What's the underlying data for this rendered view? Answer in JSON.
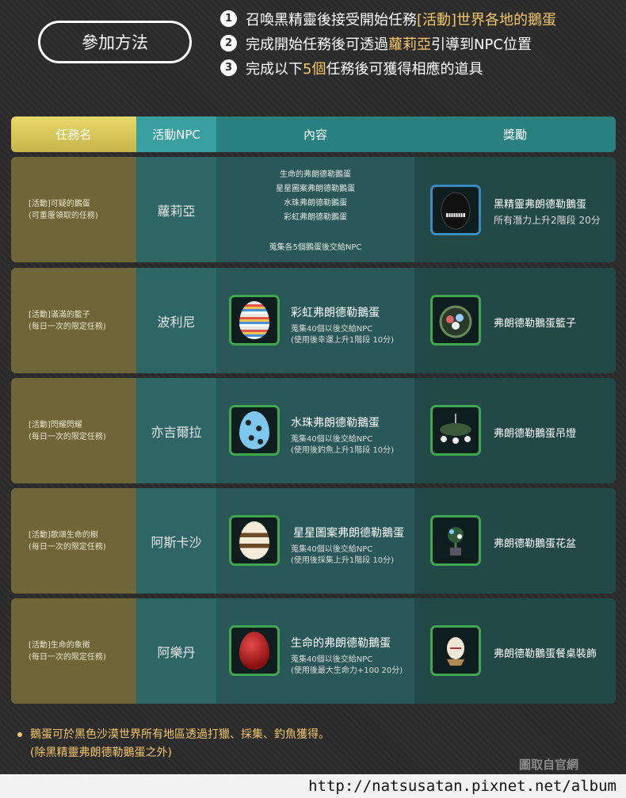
{
  "join_label": "參加方法",
  "steps": [
    {
      "num": "1",
      "pre": "召喚黑精靈後接受開始任務",
      "highlight": "[活動]世界各地的鵝蛋",
      "post": ""
    },
    {
      "num": "2",
      "pre": "完成開始任務後可透過",
      "highlight": "蘿莉亞",
      "post": "引導到NPC位置"
    },
    {
      "num": "3",
      "pre": "完成以下",
      "highlight": "5個",
      "post": "任務後可獲得相應的道具"
    }
  ],
  "headers": {
    "quest": "任務名",
    "npc": "活動NPC",
    "content": "內容",
    "reward": "獎勵"
  },
  "rows": [
    {
      "quest_title": "[活動]可疑的鵝蛋",
      "quest_note": "(可重覆領取的任務)",
      "npc": "蘿莉亞",
      "content_lines": [
        "生命的弗朗德勒鵝蛋",
        "星星圖案弗朗德勒鵝蛋",
        "水珠弗朗德勒鵝蛋",
        "彩虹弗朗德勒鵝蛋"
      ],
      "content_footer": "蒐集各5個鵝蛋後交給NPC",
      "reward_name": "黑精靈弗朗德勒鵝蛋",
      "reward_desc": "所有潛力上升2階段 20分",
      "reward_icon": "black-spirit-egg-icon"
    },
    {
      "quest_title": "[活動]滿滿的籃子",
      "quest_note": "(每日一次的限定任務)",
      "npc": "波利尼",
      "item_name": "彩虹弗朗德勒鵝蛋",
      "item_desc1": "蒐集40個以後交給NPC",
      "item_desc2": "(使用後幸運上升1階段 10分)",
      "item_icon": "rainbow-egg-icon",
      "reward_name": "弗朗德勒鵝蛋籃子",
      "reward_icon": "egg-basket-icon"
    },
    {
      "quest_title": "[活動]閃耀閃耀",
      "quest_note": "(每日一次的限定任務)",
      "npc": "亦吉爾拉",
      "item_name": "水珠弗朗德勒鵝蛋",
      "item_desc1": "蒐集40個以後交給NPC",
      "item_desc2": "(使用後釣魚上升1階段 10分)",
      "item_icon": "polka-dot-egg-icon",
      "reward_name": "弗朗德勒鵝蛋吊燈",
      "reward_icon": "egg-chandelier-icon"
    },
    {
      "quest_title": "[活動]歌頌生命的樹",
      "quest_note": "(每日一次的限定任務)",
      "npc": "阿斯卡沙",
      "item_name": "星星圖案弗朗德勒鵝蛋",
      "item_desc1": "蒐集40個以後交給NPC",
      "item_desc2": "(使用後採集上升1階段 10分)",
      "item_icon": "star-egg-icon",
      "reward_name": "弗朗德勒鵝蛋花盆",
      "reward_icon": "egg-flowerpot-icon"
    },
    {
      "quest_title": "[活動]生命的象徵",
      "quest_note": "(每日一次的限定任務)",
      "npc": "阿樂丹",
      "item_name": "生命的弗朗德勒鵝蛋",
      "item_desc1": "蒐集40個以後交給NPC",
      "item_desc2": "(使用後最大生命力+100 20分)",
      "item_icon": "life-egg-icon",
      "reward_name": "弗朗德勒鵝蛋餐桌裝飾",
      "reward_icon": "egg-table-decoration-icon"
    }
  ],
  "note_line1": "鵝蛋可於黑色沙漠世界所有地區透過打獵、採集、釣魚獲得。",
  "note_line2": "(除黑精靈弗朗德勒鵝蛋之外)",
  "source_label": "圖取自官網",
  "url": "http://natsusatan.pixnet.net/album",
  "colors": {
    "highlight": "#f5c76a",
    "green_frame": "#3fa84f",
    "blue_frame": "#3b8bbf"
  }
}
